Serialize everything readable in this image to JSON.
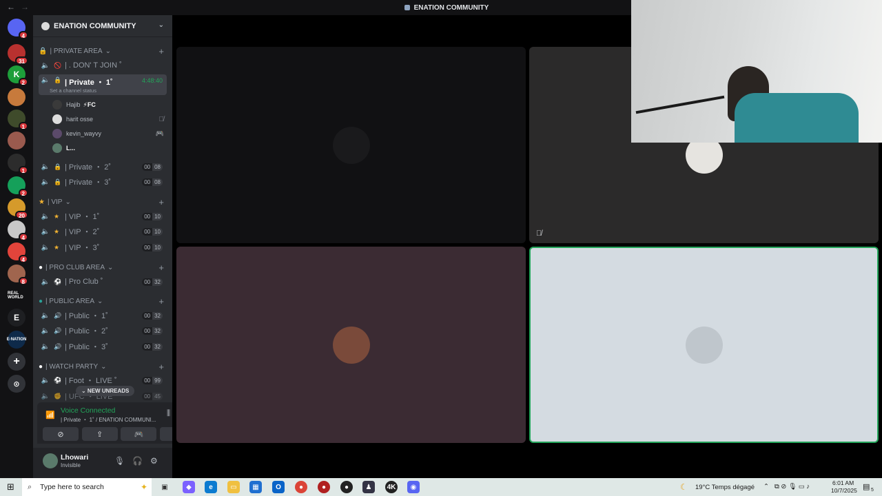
{
  "window": {
    "title": "ENATION COMMUNITY",
    "back": "←",
    "forward": "→"
  },
  "servers": [
    {
      "name": "discord-home",
      "label": "",
      "badge": "4",
      "color": "#5865f2"
    },
    {
      "name": "server-1",
      "label": "",
      "badge": "31",
      "color": "#b8312f"
    },
    {
      "name": "server-k",
      "label": "K",
      "badge": "2",
      "color": "#1e9e3a"
    },
    {
      "name": "server-3",
      "label": "",
      "badge": "",
      "color": "#c77a3c"
    },
    {
      "name": "server-4",
      "label": "",
      "badge": "1",
      "color": "#3f4b2b"
    },
    {
      "name": "server-5",
      "label": "",
      "badge": "",
      "color": "#9a5a4e"
    },
    {
      "name": "server-6",
      "label": "",
      "badge": "1",
      "color": "#2c2c2c"
    },
    {
      "name": "server-7",
      "label": "",
      "badge": "2",
      "color": "#15a05a"
    },
    {
      "name": "server-8",
      "label": "",
      "badge": "20",
      "color": "#d59a2b"
    },
    {
      "name": "server-9",
      "label": "",
      "badge": "4",
      "color": "#c8c8c8"
    },
    {
      "name": "server-10",
      "label": "",
      "badge": "4",
      "color": "#e2443b"
    },
    {
      "name": "server-11",
      "label": "",
      "badge": "8",
      "color": "#a0654e"
    },
    {
      "name": "server-real-world",
      "label": "REAL WORLD",
      "badge": "",
      "color": "#121214"
    },
    {
      "name": "server-e",
      "label": "E",
      "badge": "",
      "color": "#1e1f22"
    },
    {
      "name": "server-enation",
      "label": "E·NATION",
      "badge": "",
      "color": "#0e2a4a"
    }
  ],
  "guild": {
    "name": "ENATION COMMUNITY"
  },
  "categories": [
    {
      "label": "| PRIVATE AREA",
      "emoji": "🔒"
    },
    {
      "label": "| VIP",
      "emoji": "★"
    },
    {
      "label": "| PRO CLUB AREA",
      "emoji": "●"
    },
    {
      "label": "| PUBLIC AREA",
      "emoji": "●"
    },
    {
      "label": "| WATCH PARTY",
      "emoji": "●"
    }
  ],
  "channels": {
    "dont_join": {
      "emoji": "🚫",
      "label": "| . DON' T JOIN ˚"
    },
    "private1": {
      "emoji": "🔒",
      "label": "| Private ・ 1˚",
      "timer": "4:48:40",
      "status": "Set a channel status"
    },
    "private2": {
      "emoji": "🔒",
      "label": "| Private ・ 2˚",
      "a": "00",
      "b": "08"
    },
    "private3": {
      "emoji": "🔒",
      "label": "| Private ・ 3˚",
      "a": "00",
      "b": "08"
    },
    "vip1": {
      "emoji": "★",
      "label": "| VIP ・ 1˚",
      "a": "00",
      "b": "10"
    },
    "vip2": {
      "emoji": "★",
      "label": "| VIP ・ 2˚",
      "a": "00",
      "b": "10"
    },
    "vip3": {
      "emoji": "★",
      "label": "| VIP ・ 3˚",
      "a": "00",
      "b": "10"
    },
    "proclub": {
      "emoji": "⚽",
      "label": "| Pro Club ˚",
      "a": "00",
      "b": "32"
    },
    "public1": {
      "emoji": "🔊",
      "label": "| Public ・ 1˚",
      "a": "00",
      "b": "32"
    },
    "public2": {
      "emoji": "🔊",
      "label": "| Public ・ 2˚",
      "a": "00",
      "b": "32"
    },
    "public3": {
      "emoji": "🔊",
      "label": "| Public ・ 3˚",
      "a": "00",
      "b": "32"
    },
    "foot": {
      "emoji": "⚽",
      "label": "| Foot ・ LIVE ˚",
      "a": "00",
      "b": "99"
    },
    "ufc": {
      "emoji": "✊",
      "label": "| UFC ・ LIVE",
      "a": "00",
      "b": "45"
    }
  },
  "voice_users": [
    {
      "name": "Hajib",
      "tag": "⚡FC",
      "icon": ""
    },
    {
      "name": "harit osse",
      "tag": "",
      "icon": "🎙̸"
    },
    {
      "name": "kevin_wayvy",
      "tag": "",
      "icon": "🎮"
    },
    {
      "name": "L...",
      "tag": "",
      "icon": ""
    }
  ],
  "new_unreads": "⌄ NEW UNREADS",
  "voice_panel": {
    "status": "Voice Connected",
    "channel": "| Private ・ 1˚ / ENATION COMMUNI..."
  },
  "user": {
    "name": "Lhowari",
    "status": "Invisible"
  },
  "taskbar": {
    "search_placeholder": "Type here to search",
    "weather": "19°C  Temps dégagé",
    "time": "6:01 AM",
    "date": "10/7/2025",
    "notif": "5"
  }
}
